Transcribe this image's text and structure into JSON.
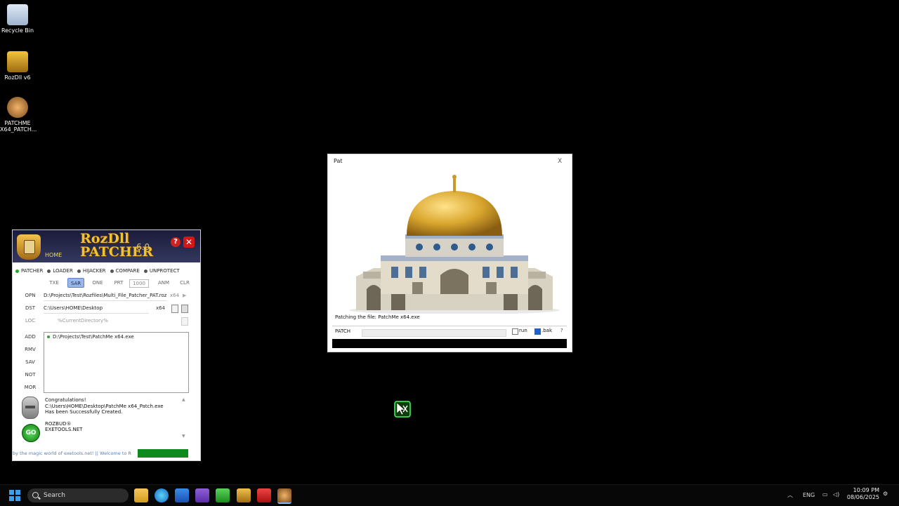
{
  "desktop": {
    "icons": [
      {
        "label": "Recycle Bin"
      },
      {
        "label": "RozDll v6"
      },
      {
        "label_line1": "PATCHME",
        "label_line2": "X64_PATCH..."
      }
    ]
  },
  "rozdll": {
    "home": "HOME",
    "title_line1": "RozDll",
    "title_line2": "PATCHER",
    "version": "6.0",
    "help": "?",
    "close": "✕",
    "modes": [
      "PATCHER",
      "LOADER",
      "HIJACKER",
      "COMPARE",
      "UNPROTECT"
    ],
    "options": {
      "txe": "TXE",
      "sar": "SAR",
      "one": "ONE",
      "prt": "PRT",
      "num": "1000",
      "anm": "ANM",
      "clr": "CLR"
    },
    "opn_label": "OPN",
    "opn_path": "D:\\Projects\\Test\\Rozfiles\\Multi_File_Patcher_PAT.roz",
    "opn_arch": "x64",
    "dst_label": "DST",
    "dst_path": "C:\\Users\\HOME\\Desktop",
    "dst_arch": "x64",
    "loc_label": "LOC",
    "loc_path": "%CurrentDirectory%",
    "side_buttons": [
      "ADD",
      "RMV",
      "SAV",
      "NOT",
      "MOR"
    ],
    "file_list": [
      "D:\\Projects\\Test\\PatchMe x64.exe"
    ],
    "go": "GO",
    "log": [
      "Congratulations!",
      "C:\\Users\\HOME\\Desktop\\PatchMe x64_Patch.exe",
      "Has been Successfully Created.",
      "",
      "ROZBUD®",
      "EXETOOLS.NET"
    ],
    "ticker": "by the magic world of exetools.net! || Welcome to R"
  },
  "pat_dialog": {
    "title": "Pat",
    "close": "X",
    "message": "Patching the file: PatchMe x64.exe",
    "patch_button": "PATCH",
    "progress": 0,
    "run_label": "run",
    "run_checked": false,
    "bak_label": ".bak",
    "bak_checked": true,
    "help": "?"
  },
  "taskbar": {
    "search_placeholder": "Search",
    "language": "ENG",
    "time": "10:09 PM",
    "date": "08/06/2025"
  },
  "colors": {
    "accent": "#0e8a1e",
    "title_gold": "#f1c232",
    "brand_red": "#d01818"
  }
}
